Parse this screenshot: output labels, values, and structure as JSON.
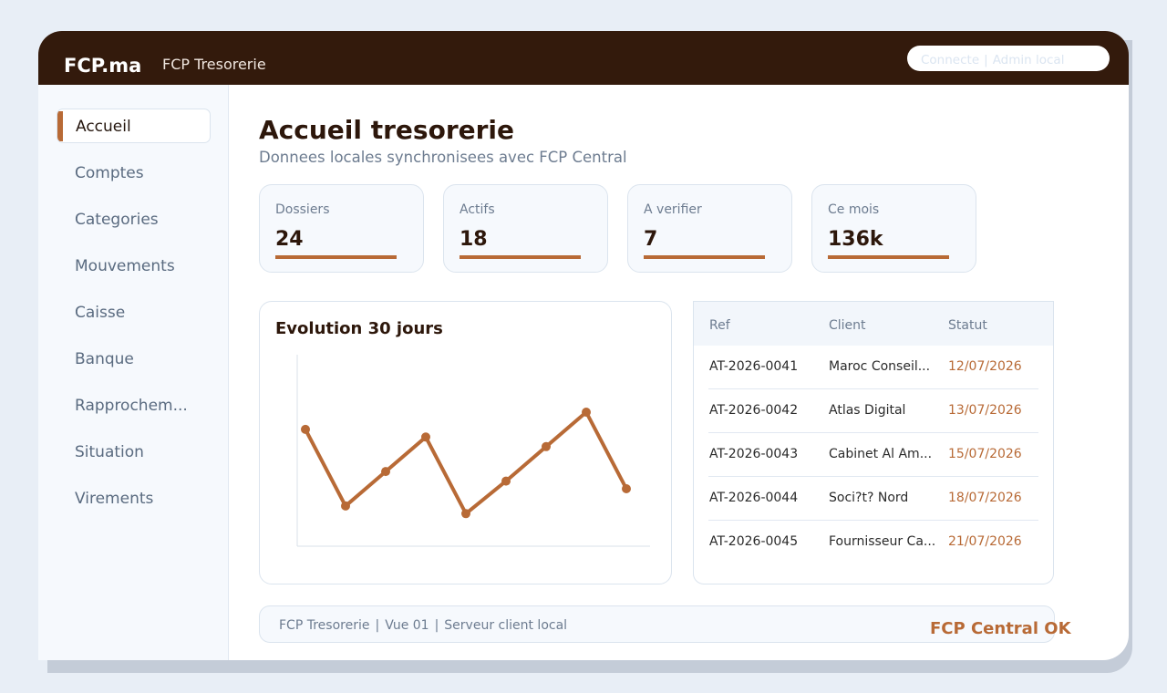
{
  "header": {
    "brand": "FCP.ma",
    "app_title": "FCP Tresorerie",
    "user": {
      "status": "Connecte",
      "role": "Admin local"
    }
  },
  "sidebar": {
    "items": [
      {
        "label": "Accueil",
        "active": true
      },
      {
        "label": "Comptes"
      },
      {
        "label": "Categories"
      },
      {
        "label": "Mouvements"
      },
      {
        "label": "Caisse"
      },
      {
        "label": "Banque"
      },
      {
        "label": "Rapprochem..."
      },
      {
        "label": "Situation"
      },
      {
        "label": "Virements"
      }
    ]
  },
  "main": {
    "title": "Accueil tresorerie",
    "subtitle": "Donnees locales synchronisees avec FCP Central",
    "stats": [
      {
        "label": "Dossiers",
        "value": "24"
      },
      {
        "label": "Actifs",
        "value": "18"
      },
      {
        "label": "A verifier",
        "value": "7"
      },
      {
        "label": "Ce mois",
        "value": "136k"
      }
    ],
    "chart_title": "Evolution 30 jours",
    "table": {
      "headers": [
        "Ref",
        "Client",
        "Statut"
      ],
      "rows": [
        [
          "AT-2026-0041",
          "Maroc Conseil...",
          "12/07/2026"
        ],
        [
          "AT-2026-0042",
          "Atlas Digital",
          "13/07/2026"
        ],
        [
          "AT-2026-0043",
          "Cabinet Al Am...",
          "15/07/2026"
        ],
        [
          "AT-2026-0044",
          "Soci?t? Nord",
          "18/07/2026"
        ],
        [
          "AT-2026-0045",
          "Fournisseur Ca...",
          "21/07/2026"
        ]
      ]
    }
  },
  "footer": {
    "parts": [
      "FCP Tresorerie",
      "Vue 01",
      "Serveur client local"
    ],
    "status": "FCP Central OK"
  },
  "colors": {
    "topbar": "#331a0c",
    "accent": "#b86a36",
    "heading": "#2d170b",
    "muted": "#6d7c90",
    "sidebar_bg": "#f6f9fd",
    "border": "#dbe4ee",
    "page_bg": "#e8eef6"
  },
  "chart_data": {
    "type": "line",
    "title": "Evolution 30 jours",
    "xlabel": "",
    "ylabel": "",
    "x": [
      1,
      2,
      3,
      4,
      5,
      6,
      7,
      8,
      9
    ],
    "series": [
      {
        "values": [
          61,
          21,
          39,
          57,
          17,
          34,
          52,
          70,
          30
        ]
      }
    ],
    "ylim": [
      0,
      100
    ],
    "grid": false,
    "legend": "none"
  }
}
